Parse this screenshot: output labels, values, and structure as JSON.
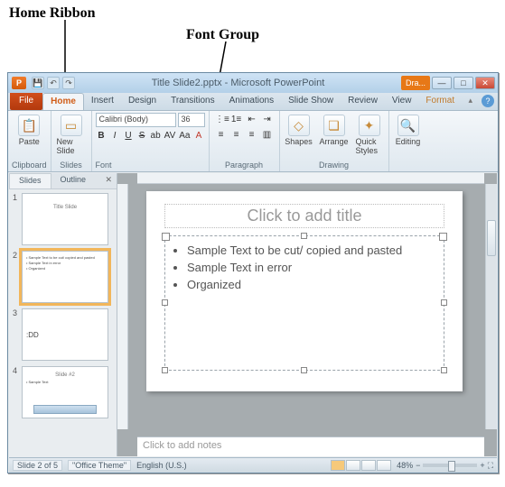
{
  "annotations": {
    "home_ribbon": "Home Ribbon",
    "font_group": "Font Group"
  },
  "titlebar": {
    "app_letter": "P",
    "title": "Title Slide2.pptx - Microsoft PowerPoint",
    "ora": "Dra..."
  },
  "tabs": {
    "file": "File",
    "home": "Home",
    "insert": "Insert",
    "design": "Design",
    "transitions": "Transitions",
    "animations": "Animations",
    "slideshow": "Slide Show",
    "review": "Review",
    "view": "View",
    "format": "Format"
  },
  "ribbon": {
    "clipboard": {
      "paste": "Paste",
      "label": "Clipboard"
    },
    "slides": {
      "new": "New Slide",
      "label": "Slides"
    },
    "font": {
      "name": "Calibri (Body)",
      "size": "36",
      "label": "Font"
    },
    "paragraph": {
      "label": "Paragraph"
    },
    "drawing": {
      "shapes": "Shapes",
      "arrange": "Arrange",
      "quick": "Quick Styles",
      "label": "Drawing"
    },
    "editing": {
      "label": "Editing"
    }
  },
  "panel": {
    "slides_tab": "Slides",
    "outline_tab": "Outline",
    "thumbs": [
      {
        "num": "1",
        "title": "Title Slide",
        "lines": []
      },
      {
        "num": "2",
        "title": "",
        "lines": [
          "• Sample Text to be cut/ copied and pasted",
          "• Sample Text in error",
          "• Organized"
        ]
      },
      {
        "num": "3",
        "title": "",
        "lines": [
          ":DD"
        ]
      },
      {
        "num": "4",
        "title": "Slide #2",
        "lines": [
          "• Sample Text"
        ]
      }
    ]
  },
  "slide": {
    "title_placeholder": "Click to add title",
    "bullets": [
      "Sample Text to be cut/ copied and pasted",
      "Sample Text in error",
      "Organized"
    ]
  },
  "notes_placeholder": "Click to add notes",
  "status": {
    "slide": "Slide 2 of 5",
    "theme": "\"Office Theme\"",
    "lang": "English (U.S.)",
    "zoom": "48%"
  }
}
